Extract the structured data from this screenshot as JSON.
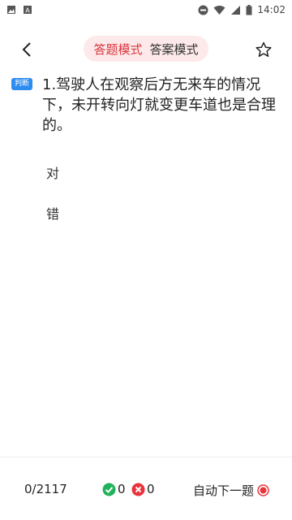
{
  "status_bar": {
    "time": "14:02",
    "icons": [
      "image-icon",
      "a-icon",
      "do-not-disturb-icon",
      "wifi-icon",
      "cellular-icon",
      "battery-icon"
    ]
  },
  "nav": {
    "modes": [
      {
        "label": "答题模式",
        "active": true
      },
      {
        "label": "答案模式",
        "active": false
      }
    ]
  },
  "question": {
    "type_badge": "判断",
    "text": "1.驾驶人在观察后方无来车的情况下，未开转向灯就变更车道也是合理的。",
    "options": [
      "对",
      "错"
    ]
  },
  "footer": {
    "progress": "0/2117",
    "correct_count": "0",
    "wrong_count": "0",
    "auto_next_label": "自动下一题"
  },
  "colors": {
    "accent": "#d9363e",
    "badge": "#2d8cf0",
    "correct": "#21b35b",
    "wrong": "#e8333b",
    "mode_bg": "#fde9ea"
  }
}
